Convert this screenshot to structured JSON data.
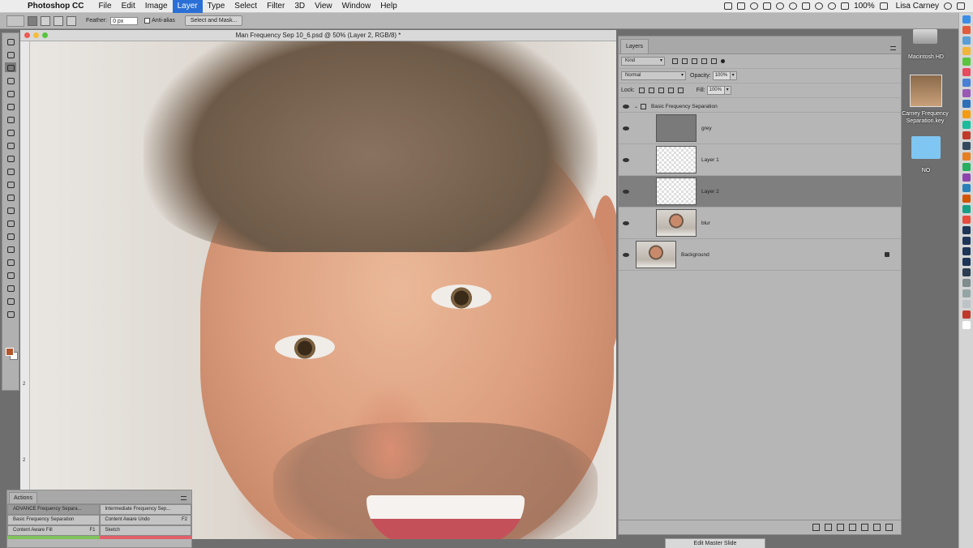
{
  "menubar": {
    "app_name": "Photoshop CC",
    "items": [
      "File",
      "Edit",
      "Image",
      "Layer",
      "Type",
      "Select",
      "Filter",
      "3D",
      "View",
      "Window",
      "Help"
    ],
    "active_item": "Layer",
    "battery": "100%",
    "user": "Lisa Carney"
  },
  "options_bar": {
    "feather_label": "Feather:",
    "feather_value": "0 px",
    "antialias_label": "Anti-alias",
    "select_mask_label": "Select and Mask..."
  },
  "document": {
    "title": "Man Frequency Sep 10_6.psd @ 50% (Layer 2, RGB/8) *",
    "ruler_marks": [
      "2",
      "2"
    ]
  },
  "layers_panel": {
    "tab": "Layers",
    "filter_kind": "Kind",
    "blend_mode": "Normal",
    "opacity_label": "Opacity:",
    "opacity_value": "100%",
    "lock_label": "Lock:",
    "fill_label": "Fill:",
    "fill_value": "100%",
    "group_name": "Basic Frequency Separation",
    "layers": [
      {
        "name": "grey"
      },
      {
        "name": "Layer 1"
      },
      {
        "name": "Layer 2"
      },
      {
        "name": "blur"
      },
      {
        "name": "Background"
      }
    ],
    "selected_layer": "Layer 2"
  },
  "actions_panel": {
    "tab": "Actions",
    "buttons": [
      {
        "label": "ADVANCE Frequency Separa...",
        "key": ""
      },
      {
        "label": "Intermediate Frequency Sep...",
        "key": ""
      },
      {
        "label": "Basic Frequency Separation",
        "key": ""
      },
      {
        "label": "Content Aware Undo",
        "key": "F2"
      },
      {
        "label": "Content Aware Fill",
        "key": "F1"
      },
      {
        "label": "Sketch",
        "key": ""
      }
    ]
  },
  "desktop": {
    "drive_label": "Macintosh HD",
    "file_label": "Carney Frequency Separation.key",
    "folder_label": "NO"
  },
  "keynote": {
    "edit_master_label": "Edit Master Slide"
  },
  "colors": {
    "foreground": "#b3562c",
    "background": "#ffffff",
    "menu_active": "#2a6fd6"
  }
}
